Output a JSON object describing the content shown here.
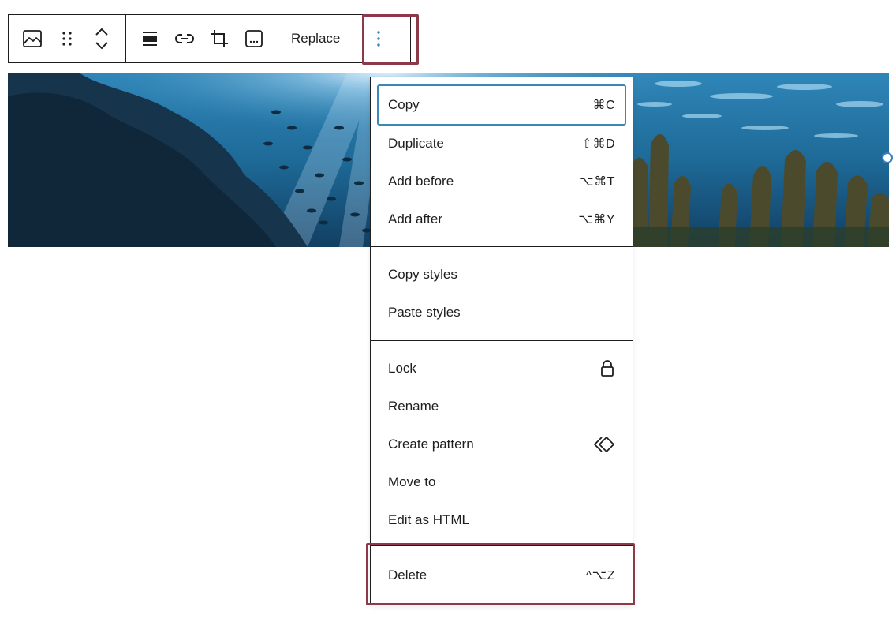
{
  "toolbar": {
    "icons": {
      "block_type": "image-icon",
      "drag": "drag-handle-icon",
      "move_up": "chevron-up-icon",
      "move_down": "chevron-down-icon",
      "align": "align-icon",
      "link": "link-icon",
      "crop": "crop-icon",
      "caption": "caption-icon",
      "options": "more-vertical-icon"
    },
    "replace_label": "Replace"
  },
  "menu": {
    "section1": [
      {
        "label": "Copy",
        "shortcut": "⌘C"
      },
      {
        "label": "Duplicate",
        "shortcut": "⇧⌘D"
      },
      {
        "label": "Add before",
        "shortcut": "⌥⌘T"
      },
      {
        "label": "Add after",
        "shortcut": "⌥⌘Y"
      }
    ],
    "section2": [
      {
        "label": "Copy styles"
      },
      {
        "label": "Paste styles"
      }
    ],
    "section3": [
      {
        "label": "Lock",
        "icon": "lock-icon"
      },
      {
        "label": "Rename"
      },
      {
        "label": "Create pattern",
        "icon": "symbol-icon"
      },
      {
        "label": "Move to"
      },
      {
        "label": "Edit as HTML"
      }
    ],
    "section4": [
      {
        "label": "Delete",
        "shortcut": "^⌥Z"
      }
    ]
  },
  "colors": {
    "highlight": "#8b3b47",
    "focus": "#3a87b8",
    "ink": "#1e1e1e"
  }
}
